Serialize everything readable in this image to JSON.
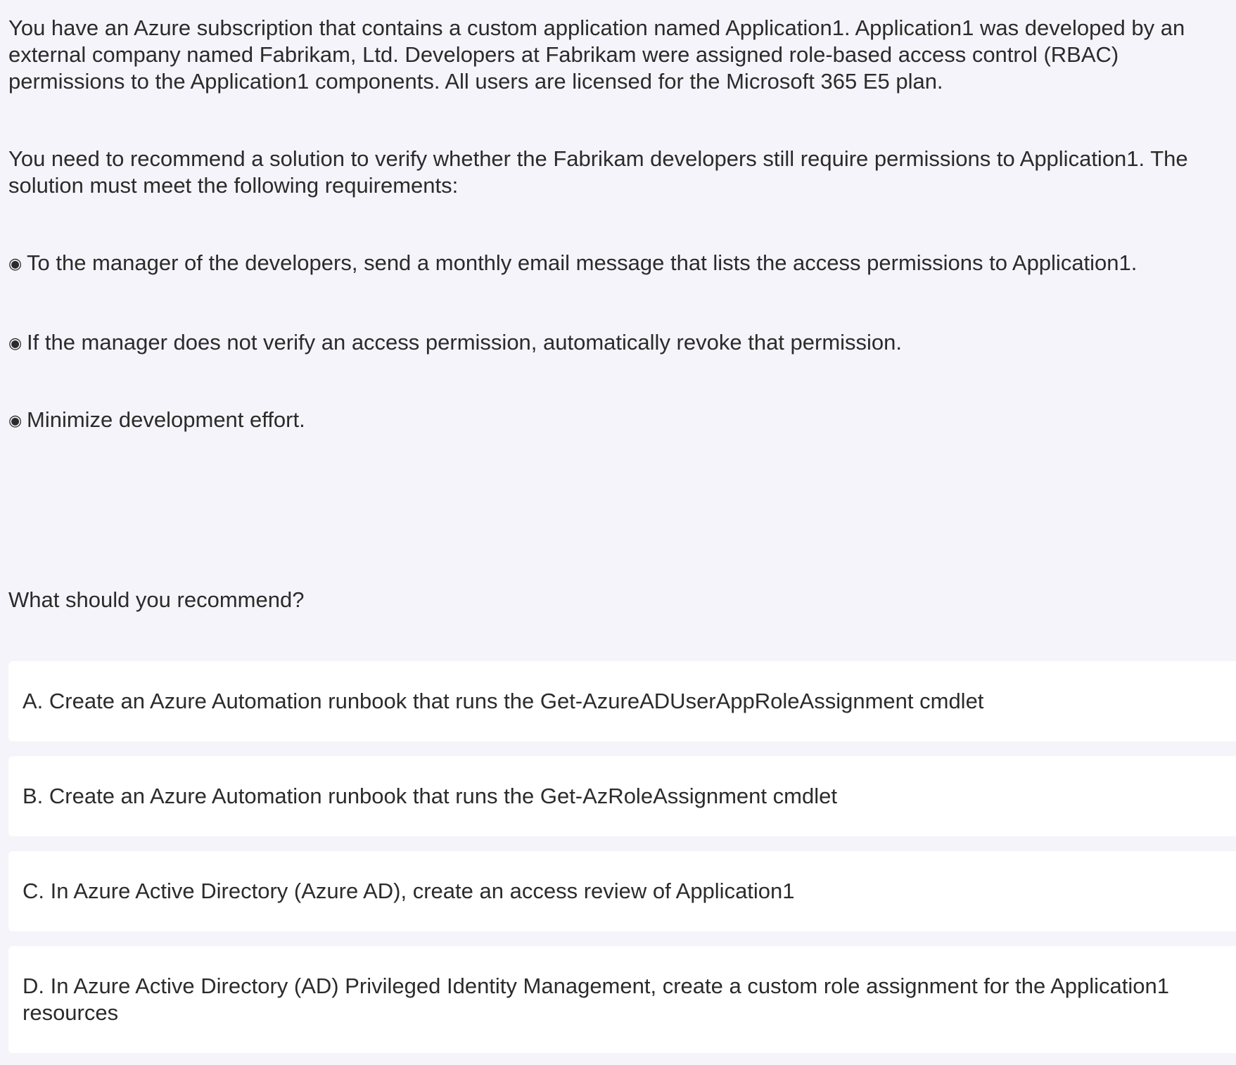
{
  "question": {
    "paragraphs": [
      "You have an Azure subscription that contains a custom application named Application1. Application1 was developed by an external company named Fabrikam, Ltd. Developers at Fabrikam were assigned role-based access control (RBAC) permissions to the Application1 components. All users are licensed for the Microsoft 365 E5 plan.",
      "You need to recommend a solution to verify whether the Fabrikam developers still require permissions to Application1. The solution must meet the following requirements:"
    ],
    "bullet_glyph": "◉",
    "requirements": [
      "To the manager of the developers, send a monthly email message that lists the access permissions to Application1.",
      "If the manager does not verify an access permission, automatically revoke that permission.",
      "Minimize development effort."
    ],
    "prompt": "What should you recommend?"
  },
  "options": [
    "A. Create an Azure Automation runbook that runs the Get-AzureADUserAppRoleAssignment cmdlet",
    "B. Create an Azure Automation runbook that runs the Get-AzRoleAssignment cmdlet",
    "C. In Azure Active Directory (Azure AD), create an access review of Application1",
    "D. In Azure Active Directory (AD) Privileged Identity Management, create a custom role assignment for the Application1 resources"
  ],
  "colors": {
    "page_background": "#f4f4fa",
    "option_background": "#ffffff",
    "text": "#2b2b2b"
  }
}
